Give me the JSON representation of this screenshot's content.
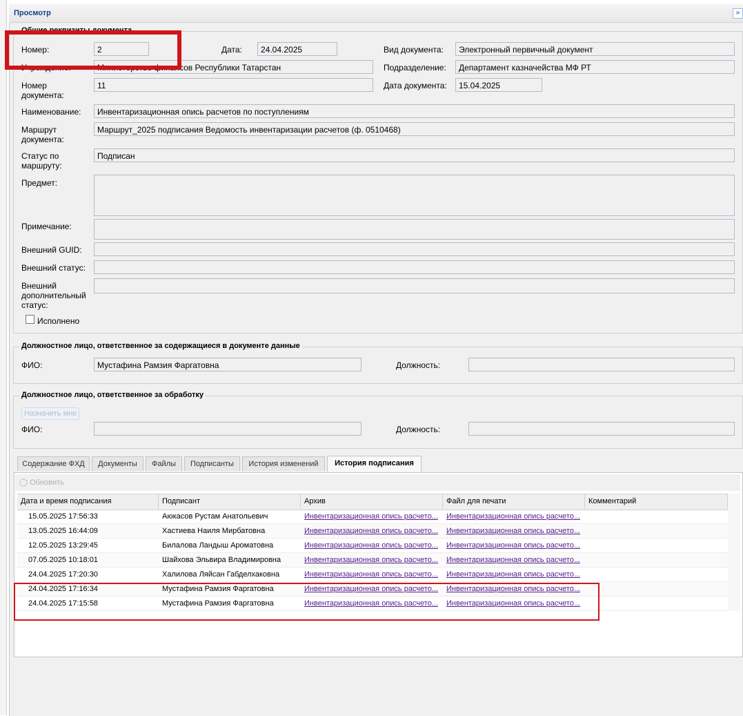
{
  "panel": {
    "title": "Просмотр",
    "collapse_glyph": "»"
  },
  "general": {
    "legend": "Общие реквизиты документа",
    "nomer_label": "Номер:",
    "nomer_value": "2",
    "data_label": "Дата:",
    "data_value": "24.04.2025",
    "vid_label": "Вид документа:",
    "vid_value": "Электронный первичный документ",
    "org_label": "Учреждение:",
    "org_value": "Министерство финансов Республики Татарстан",
    "podr_label": "Подразделение:",
    "podr_value": "Департамент казначейства МФ РТ",
    "nomer_doc_label_1": "Номер",
    "nomer_doc_label_2": "документа:",
    "nomer_doc_value": "11",
    "data_doc_label": "Дата документа:",
    "data_doc_value": "15.04.2025",
    "name_label": "Наименование:",
    "name_value": "Инвентаризационная опись расчетов по поступлениям",
    "route_label_1": "Маршрут",
    "route_label_2": "документа:",
    "route_value": "Маршрут_2025 подписания Ведомость инвентаризации расчетов (ф. 0510468)",
    "status_label_1": "Статус по",
    "status_label_2": "маршруту:",
    "status_value": "Подписан",
    "predmet_label": "Предмет:",
    "predmet_value": "",
    "note_label": "Примечание:",
    "note_value": "",
    "guid_label": "Внешний GUID:",
    "guid_value": "",
    "ext_status_label": "Внешний статус:",
    "ext_status_value": "",
    "ext_add_label_1": "Внешний",
    "ext_add_label_2": "дополнительный",
    "ext_add_label_3": "статус:",
    "ext_add_value": "",
    "done_label": "Исполнено"
  },
  "responsible_data": {
    "legend": "Должностное лицо, ответственное за содержащиеся в документе данные",
    "fio_label": "ФИО:",
    "fio_value": "Мустафина Рамзия Фаргатовна",
    "position_label": "Должность:",
    "position_value": ""
  },
  "responsible_processing": {
    "legend": "Должностное лицо, ответственное за обработку",
    "assign_label": "Назначить мне",
    "fio_label": "ФИО:",
    "fio_value": "",
    "position_label": "Должность:",
    "position_value": ""
  },
  "tabs": [
    {
      "label": "Содержание ФХД"
    },
    {
      "label": "Документы"
    },
    {
      "label": "Файлы"
    },
    {
      "label": "Подписанты"
    },
    {
      "label": "История изменений"
    },
    {
      "label": "История подписания"
    }
  ],
  "grid": {
    "refresh_label": "Обновить",
    "columns": [
      "Дата и время подписания",
      "Подписант",
      "Архив",
      "Файл для печати",
      "Комментарий"
    ],
    "rows": [
      {
        "datetime": "15.05.2025 17:56:33",
        "signer": "Аюкасов Рустам Анатольевич",
        "archive": "Инвентаризационная опись расчето...",
        "print": "Инвентаризационная опись расчето...",
        "comment": ""
      },
      {
        "datetime": "13.05.2025 16:44:09",
        "signer": "Хастиева Наиля Мирбатовна",
        "archive": "Инвентаризационная опись расчето...",
        "print": "Инвентаризационная опись расчето...",
        "comment": ""
      },
      {
        "datetime": "12.05.2025 13:29:45",
        "signer": "Билалова Ландыш Ароматовна",
        "archive": "Инвентаризационная опись расчето...",
        "print": "Инвентаризационная опись расчето...",
        "comment": ""
      },
      {
        "datetime": "07.05.2025 10:18:01",
        "signer": "Шайхова Эльвира Владимировна",
        "archive": "Инвентаризационная опись расчето...",
        "print": "Инвентаризационная опись расчето...",
        "comment": ""
      },
      {
        "datetime": "24.04.2025 17:20:30",
        "signer": "Халилова Ляйсан Габделхаковна",
        "archive": "Инвентаризационная опись расчето...",
        "print": "Инвентаризационная опись расчето...",
        "comment": ""
      },
      {
        "datetime": "24.04.2025 17:16:34",
        "signer": "Мустафина Рамзия Фаргатовна",
        "archive": "Инвентаризационная опись расчето...",
        "print": "Инвентаризационная опись расчето...",
        "comment": ""
      },
      {
        "datetime": "24.04.2025 17:15:58",
        "signer": "Мустафина Рамзия Фаргатовна",
        "archive": "Инвентаризационная опись расчето...",
        "print": "Инвентаризационная опись расчето...",
        "comment": ""
      }
    ]
  },
  "colors": {
    "highlight": "#d0141b",
    "header_text": "#15428b",
    "link": "#551a8b"
  }
}
